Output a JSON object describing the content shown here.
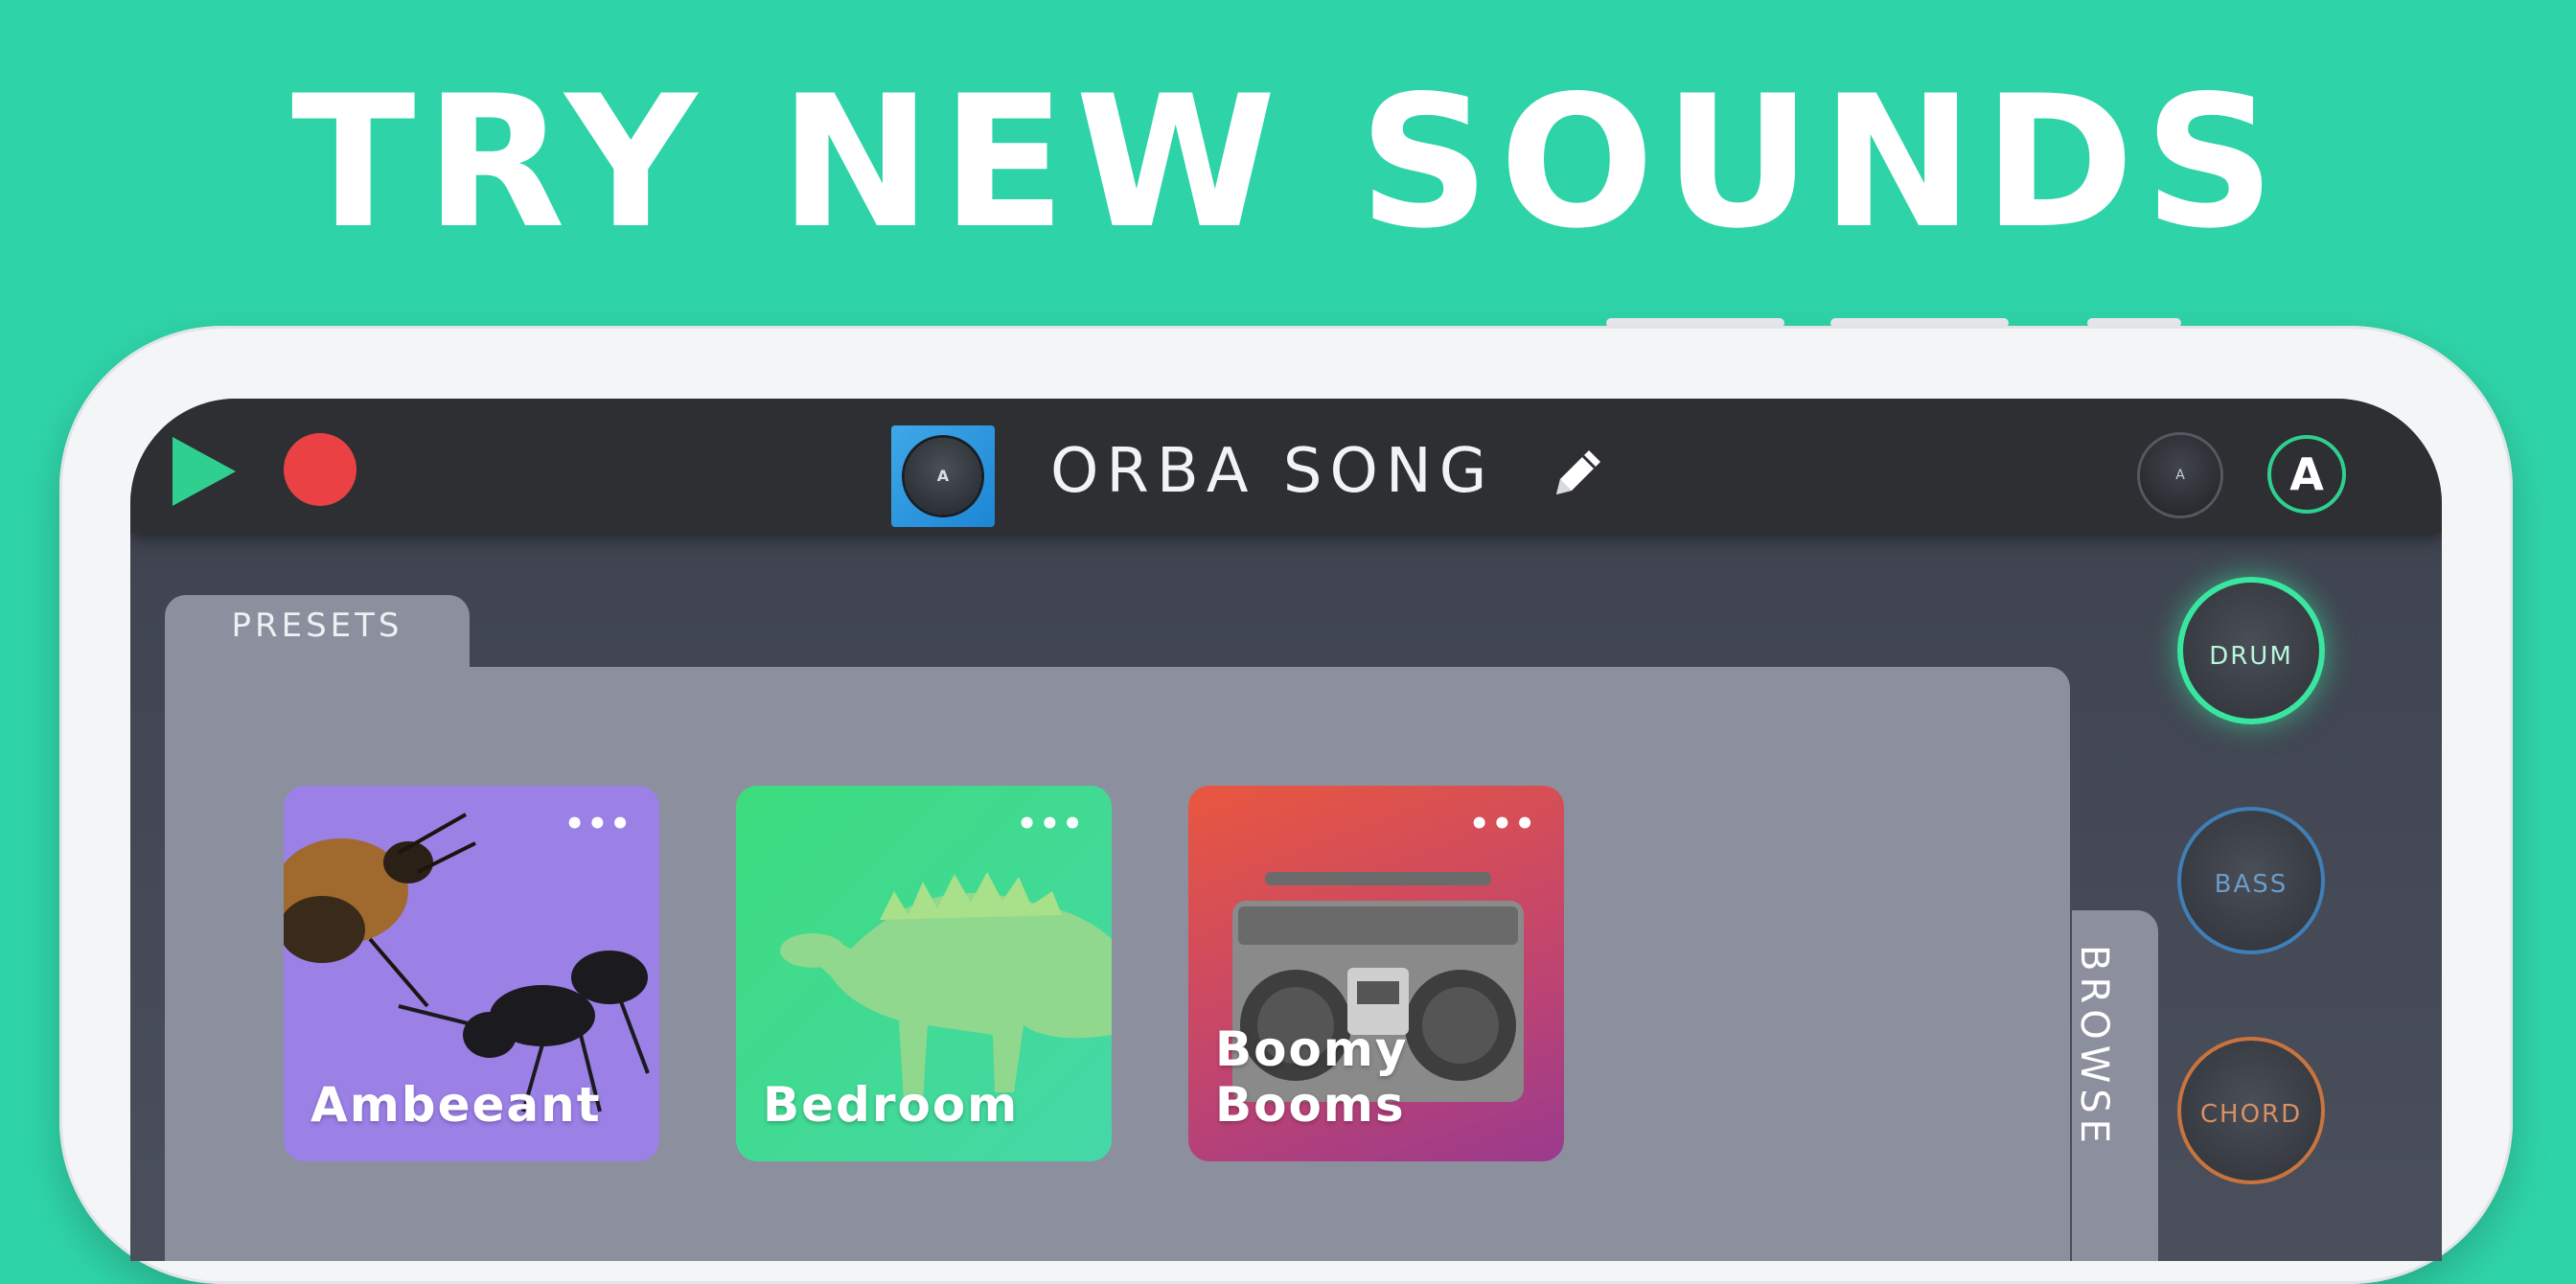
{
  "headline": "TRY NEW SOUNDS",
  "colors": {
    "background": "#2fd3a8",
    "play": "#2fd08f",
    "record": "#ea4145",
    "drum": "#39e6a0",
    "bass": "#3f7fb8",
    "chord": "#c9743f"
  },
  "topbar": {
    "play_icon": "play-icon",
    "record_icon": "record-icon",
    "song_title": "ORBA SONG",
    "edit_icon": "pencil-icon",
    "orba_knob_letter": "A",
    "account_letter": "A"
  },
  "presets": {
    "tab_label": "PRESETS",
    "more_symbol": "•••",
    "cards": [
      {
        "label": "Ambeeant"
      },
      {
        "label": "Bedroom"
      },
      {
        "label": "Boomy Booms"
      }
    ]
  },
  "browse_label": "BROWSE",
  "instruments": [
    {
      "label": "DRUM",
      "selected": true
    },
    {
      "label": "BASS",
      "selected": false
    },
    {
      "label": "CHORD",
      "selected": false
    }
  ]
}
